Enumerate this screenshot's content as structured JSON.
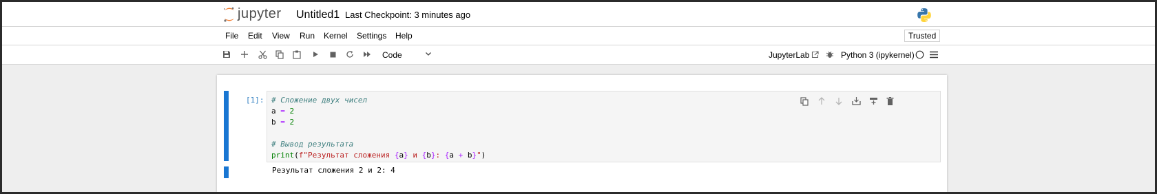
{
  "header": {
    "logo_text": "jupyter",
    "notebook_title": "Untitled1",
    "checkpoint_text": "Last Checkpoint: 3 minutes ago"
  },
  "menu": {
    "items": [
      "File",
      "Edit",
      "View",
      "Run",
      "Kernel",
      "Settings",
      "Help"
    ],
    "trusted_label": "Trusted"
  },
  "toolbar": {
    "cell_type": "Code",
    "jupyterlab_label": "JupyterLab",
    "kernel_name": "Python 3 (ipykernel)"
  },
  "cell": {
    "prompt": "[1]:",
    "code_lines": [
      "# Сложение двух чисел",
      "a = 2",
      "b = 2",
      "",
      "# Вывод результата",
      "print(f\"Результат сложения {a} и {b}: {a + b}\")"
    ],
    "output": "Результат сложения 2 и 2: 4"
  },
  "colors": {
    "accent": "#1976d2",
    "jupyter_orange": "#f37726",
    "comment": "#408080",
    "keyword_purple": "#aa22ff",
    "number_green": "#008000",
    "string_red": "#ba2121"
  }
}
